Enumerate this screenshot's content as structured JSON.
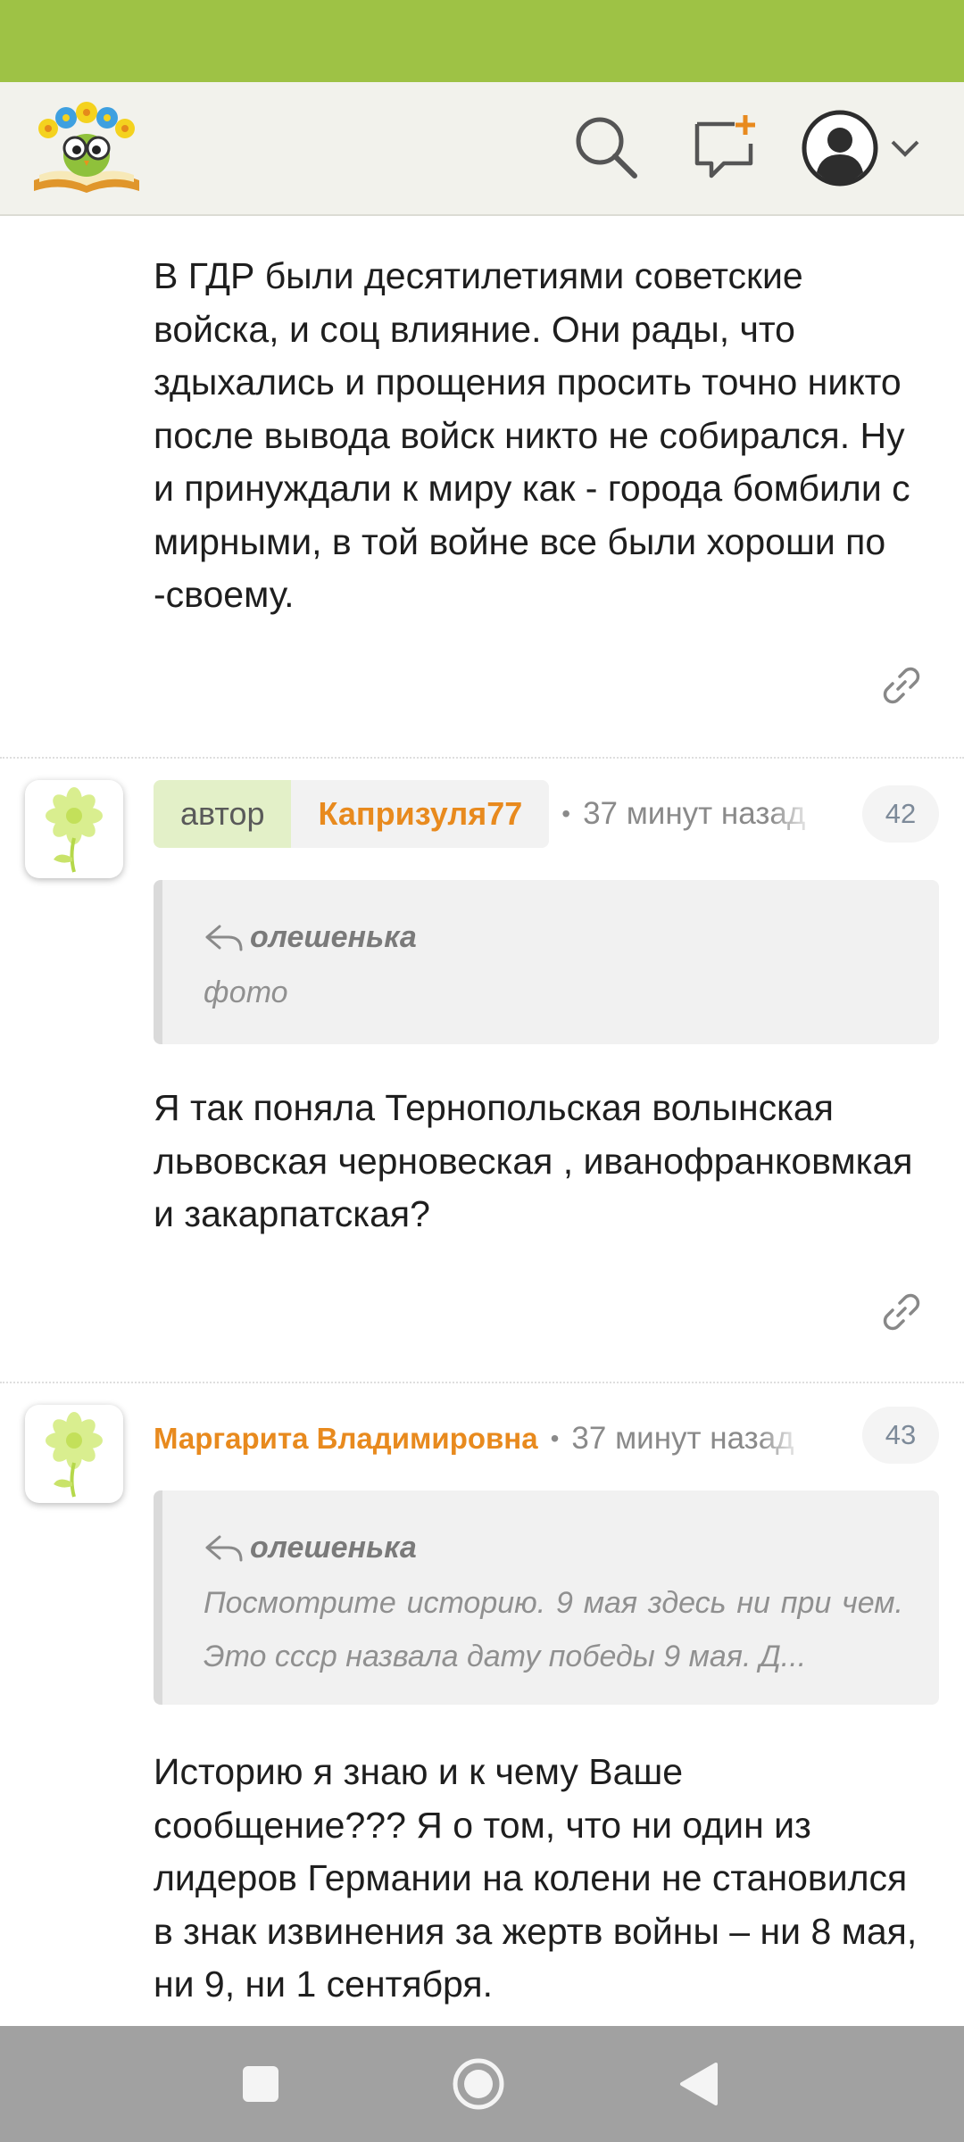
{
  "header": {
    "logo_icon": "owl-with-flowers-on-book-logo",
    "search_icon": "search-icon",
    "new_post_icon": "new-post-icon",
    "profile_icon": "user-avatar-icon"
  },
  "colors": {
    "status_bar": "#9ec245",
    "username": "#e88a1e",
    "author_tag_bg": "#e3f0c8",
    "nav_bar": "#a1a1a1"
  },
  "comments": [
    {
      "text": "В ГДР были десятилетиями советские войска, и соц влияние. Они рады, что здыхались и прощения просить точно никто после вывода войск никто не собирался. Ну и принуждали к миру как - города бомбили с мирными, в той войне все были хороши по -своему."
    },
    {
      "author_tag": "автор",
      "username": "Капризуля77",
      "dot": "•",
      "time": "37 минут назад",
      "number": "42",
      "quote": {
        "author": "олешенька",
        "text": "фото"
      },
      "text": "Я так поняла Тернопольская волынская львовская черновеская , иванофранковмкая и закарпатская?"
    },
    {
      "username": "Маргарита Владимировна",
      "dot": "•",
      "time": "37 минут назад",
      "number": "43",
      "quote": {
        "author": "олешенька",
        "text": "Посмотрите историю. 9 мая здесь ни при чем. Это ссср назвала дату победы 9 мая. Д..."
      },
      "text": "Историю я знаю и к чему Ваше сообщение??? Я о том, что ни один из лидеров Германии на колени не становился в знак извинения за жертв войны – ни 8 мая, ни 9, ни 1 сентября."
    }
  ]
}
